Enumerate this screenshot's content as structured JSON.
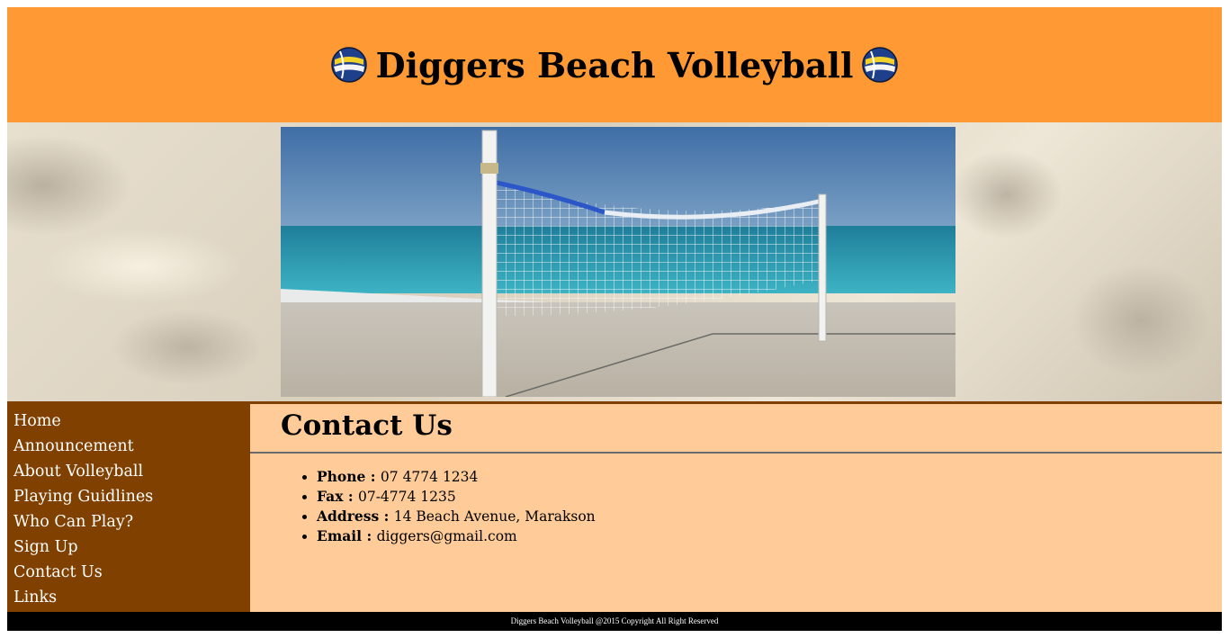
{
  "header": {
    "title": "Diggers Beach Volleyball",
    "icon_left": "volleyball-icon",
    "icon_right": "volleyball-icon",
    "background": "#ff9933"
  },
  "banner": {
    "photo_subject": "beach-volleyball-net-photo"
  },
  "sidebar": {
    "background": "#804000",
    "items": [
      {
        "label": "Home"
      },
      {
        "label": "Announcement"
      },
      {
        "label": "About Volleyball"
      },
      {
        "label": "Playing Guidlines"
      },
      {
        "label": "Who Can Play?"
      },
      {
        "label": "Sign Up"
      },
      {
        "label": "Contact Us"
      },
      {
        "label": "Links"
      }
    ]
  },
  "main": {
    "title": "Contact Us",
    "background": "#ffcc99",
    "contacts": [
      {
        "label": "Phone",
        "sep": " : ",
        "value": "07 4774 1234"
      },
      {
        "label": "Fax",
        "sep": " : ",
        "value": "07-4774 1235"
      },
      {
        "label": "Address",
        "sep": " : ",
        "value": "14 Beach Avenue, Marakson"
      },
      {
        "label": "Email",
        "sep": " : ",
        "value": "diggers@gmail.com"
      }
    ]
  },
  "footer": {
    "text": "Diggers Beach Volleyball @2015 Copyright All Right Reserved"
  }
}
